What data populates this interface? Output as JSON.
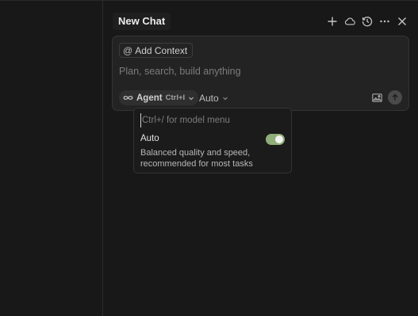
{
  "header": {
    "tab_label": "New Chat",
    "actions": [
      {
        "name": "new-chat",
        "icon": "plus-icon"
      },
      {
        "name": "cloud",
        "icon": "cloud-icon"
      },
      {
        "name": "history",
        "icon": "history-icon"
      },
      {
        "name": "more",
        "icon": "ellipsis-icon"
      },
      {
        "name": "close",
        "icon": "close-icon"
      }
    ]
  },
  "composer": {
    "add_context_label": "Add Context",
    "add_context_icon": "@",
    "input_placeholder": "Plan, search, build anything",
    "input_value": "",
    "mode": {
      "label": "Agent",
      "shortcut": "Ctrl+I",
      "icon": "infinity-icon"
    },
    "model_select": {
      "label": "Auto"
    }
  },
  "model_menu": {
    "search_placeholder": "Ctrl+/ for model menu",
    "options": [
      {
        "name": "Auto",
        "description": "Balanced quality and speed, recommended for most tasks",
        "enabled": true
      }
    ]
  },
  "colors": {
    "background": "#181818",
    "composer_bg": "#232323",
    "toggle_on": "#8fae79"
  }
}
